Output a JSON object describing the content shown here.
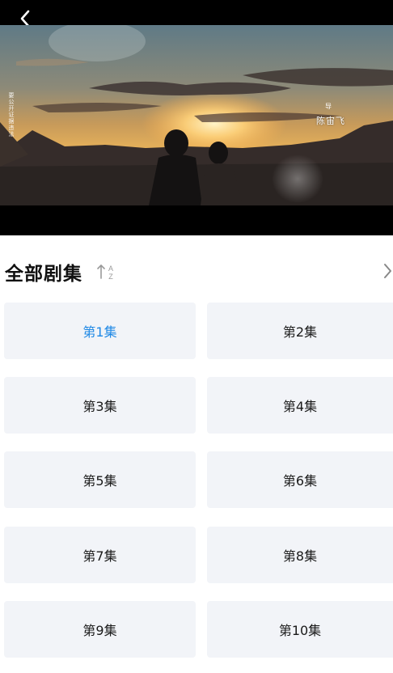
{
  "player": {
    "subtitle": "陈宙飞",
    "subtitle_mark": "导",
    "vertical_caption": "要公开证据违法"
  },
  "episodes_section": {
    "title": "全部剧集",
    "sort_az_top": "A",
    "sort_az_bottom": "Z",
    "active_index": 0,
    "accent_color": "#1e88e5",
    "items": [
      {
        "label": "第1集"
      },
      {
        "label": "第2集"
      },
      {
        "label": "第3集"
      },
      {
        "label": "第4集"
      },
      {
        "label": "第5集"
      },
      {
        "label": "第6集"
      },
      {
        "label": "第7集"
      },
      {
        "label": "第8集"
      },
      {
        "label": "第9集"
      },
      {
        "label": "第10集"
      }
    ]
  },
  "icons": {
    "back": "chevron-left-icon",
    "sort": "sort-az-icon",
    "more": "chevron-right-icon"
  }
}
